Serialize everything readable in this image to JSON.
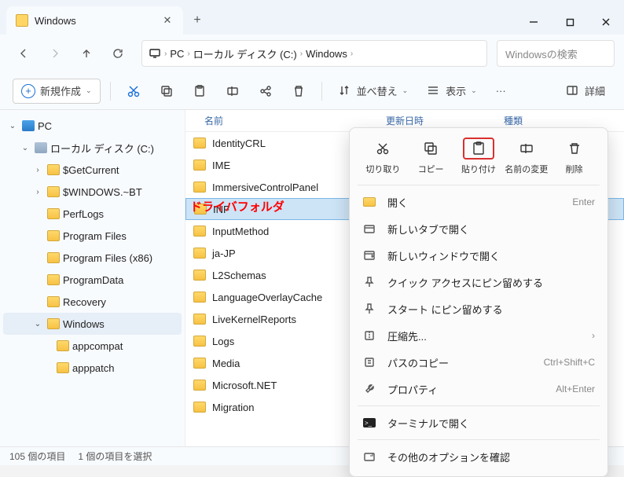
{
  "tab": {
    "title": "Windows"
  },
  "breadcrumb": {
    "items": [
      "PC",
      "ローカル ディスク (C:)",
      "Windows"
    ]
  },
  "search": {
    "placeholder": "Windowsの検索"
  },
  "toolbar": {
    "new": "新規作成",
    "sort": "並べ替え",
    "view": "表示",
    "details": "詳細"
  },
  "columns": {
    "name": "名前",
    "date": "更新日時",
    "type": "種類"
  },
  "tree": {
    "pc": "PC",
    "disk": "ローカル ディスク (C:)",
    "items": [
      "$GetCurrent",
      "$WINDOWS.~BT",
      "PerfLogs",
      "Program Files",
      "Program Files (x86)",
      "ProgramData",
      "Recovery",
      "Windows"
    ],
    "sub": [
      "appcompat",
      "apppatch"
    ]
  },
  "files": [
    "IdentityCRL",
    "IME",
    "ImmersiveControlPanel",
    "INF",
    "InputMethod",
    "ja-JP",
    "L2Schemas",
    "LanguageOverlayCache",
    "LiveKernelReports",
    "Logs",
    "Media",
    "Microsoft.NET",
    "Migration"
  ],
  "selected_file": "INF",
  "annotation": "ドライバフォルダ",
  "context": {
    "iconrow": [
      {
        "label": "切り取り",
        "name": "cut"
      },
      {
        "label": "コピー",
        "name": "copy"
      },
      {
        "label": "貼り付け",
        "name": "paste",
        "highlight": true
      },
      {
        "label": "名前の変更",
        "name": "rename"
      },
      {
        "label": "削除",
        "name": "delete"
      }
    ],
    "items": [
      {
        "label": "開く",
        "shortcut": "Enter",
        "icon": "folder"
      },
      {
        "label": "新しいタブで開く",
        "icon": "tab"
      },
      {
        "label": "新しいウィンドウで開く",
        "icon": "window"
      },
      {
        "label": "クイック アクセスにピン留めする",
        "icon": "pin"
      },
      {
        "label": "スタート にピン留めする",
        "icon": "pin"
      },
      {
        "label": "圧縮先...",
        "icon": "zip",
        "sub": true
      },
      {
        "label": "パスのコピー",
        "shortcut": "Ctrl+Shift+C",
        "icon": "copypath"
      },
      {
        "label": "プロパティ",
        "shortcut": "Alt+Enter",
        "icon": "wrench"
      },
      {
        "sep": true
      },
      {
        "label": "ターミナルで開く",
        "icon": "terminal"
      },
      {
        "sep": true
      },
      {
        "label": "その他のオプションを確認",
        "icon": "more"
      }
    ]
  },
  "status": {
    "count": "105 個の項目",
    "selected": "1 個の項目を選択"
  }
}
